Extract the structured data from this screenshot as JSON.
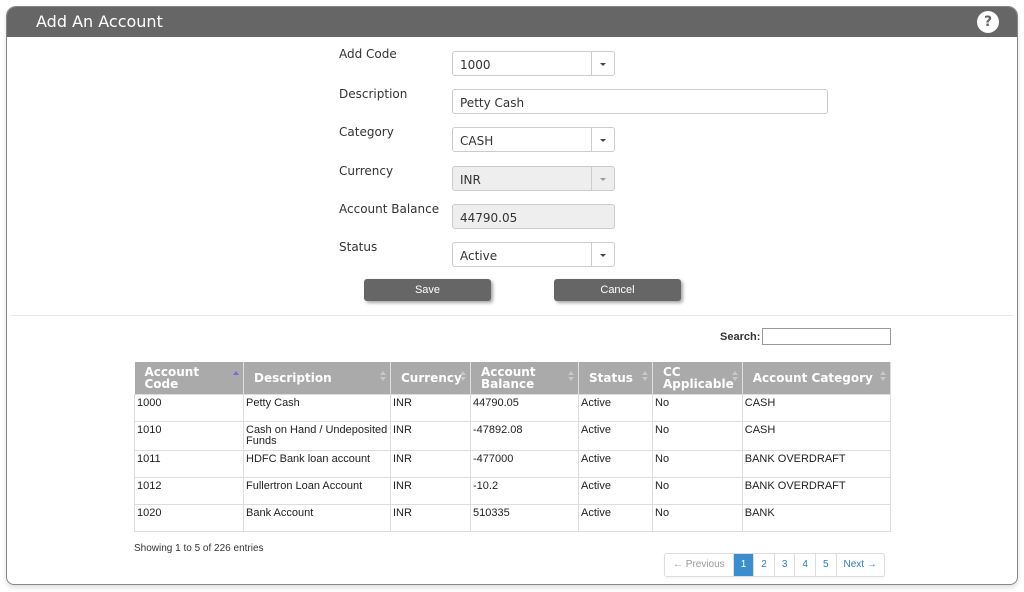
{
  "header": {
    "title": "Add An Account",
    "help_icon": "?"
  },
  "form": {
    "add_code": {
      "label": "Add Code",
      "value": "1000"
    },
    "description": {
      "label": "Description",
      "value": "Petty Cash"
    },
    "category": {
      "label": "Category",
      "value": "CASH"
    },
    "currency": {
      "label": "Currency",
      "value": "INR"
    },
    "balance": {
      "label": "Account Balance",
      "value": "44790.05"
    },
    "status": {
      "label": "Status",
      "value": "Active"
    },
    "save_label": "Save",
    "cancel_label": "Cancel"
  },
  "search": {
    "label": "Search:",
    "value": ""
  },
  "table": {
    "columns": [
      "Account Code",
      "Description",
      "Currency",
      "Account Balance",
      "Status",
      "CC Applicable",
      "Account Category"
    ],
    "rows": [
      [
        "1000",
        "Petty Cash",
        "INR",
        "44790.05",
        "Active",
        "No",
        "CASH"
      ],
      [
        "1010",
        "Cash on Hand / Undeposited Funds",
        "INR",
        "-47892.08",
        "Active",
        "No",
        "CASH"
      ],
      [
        "1011",
        "HDFC Bank loan account",
        "INR",
        "-477000",
        "Active",
        "No",
        "BANK OVERDRAFT"
      ],
      [
        "1012",
        "Fullertron Loan Account",
        "INR",
        "-10.2",
        "Active",
        "No",
        "BANK OVERDRAFT"
      ],
      [
        "1020",
        "Bank Account",
        "INR",
        "510335",
        "Active",
        "No",
        "BANK"
      ]
    ]
  },
  "info": "Showing 1 to 5 of 226 entries",
  "pager": {
    "prev": "← Previous",
    "pages": [
      "1",
      "2",
      "3",
      "4",
      "5"
    ],
    "active": "1",
    "next": "Next →"
  }
}
